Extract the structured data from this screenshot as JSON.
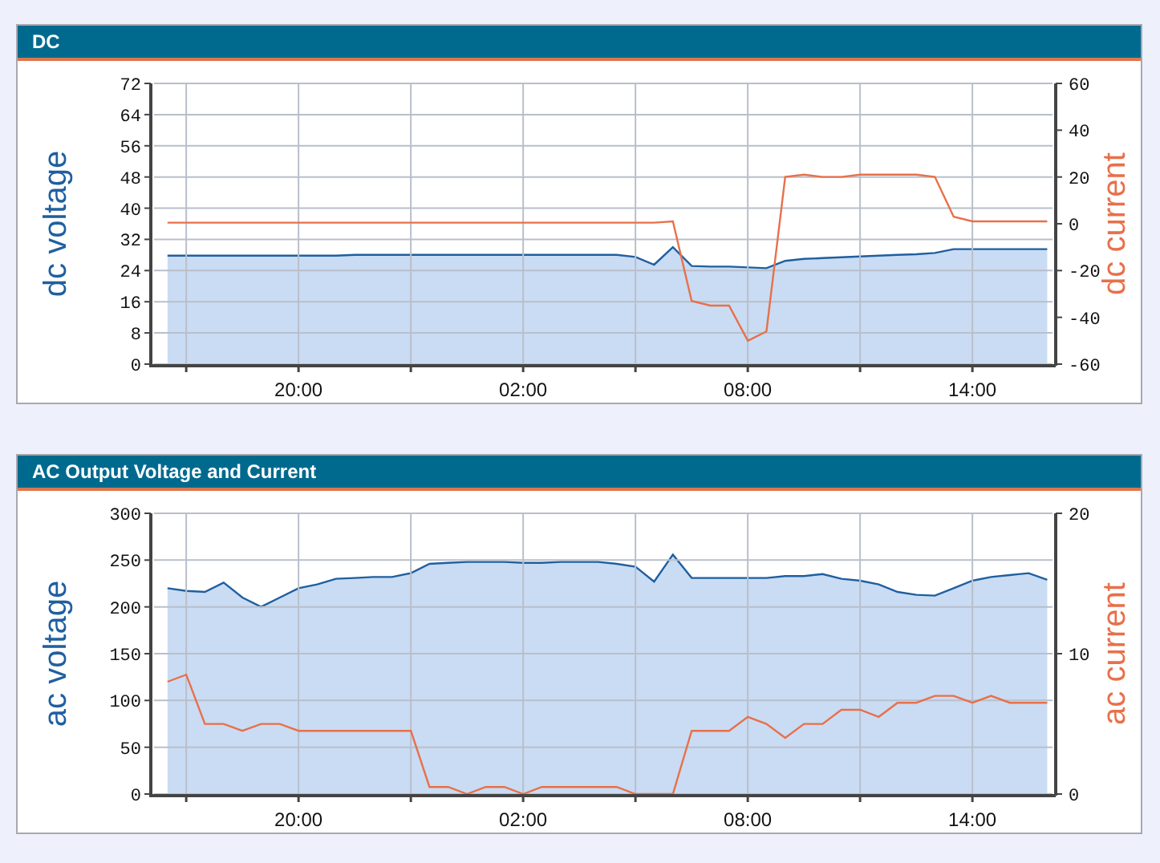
{
  "panels": [
    {
      "title": "DC",
      "chart_data": {
        "type": "area",
        "grid": true,
        "ylabel": "dc voltage",
        "y2label": "dc current",
        "categories": [
          null,
          null,
          null,
          null,
          null,
          null,
          null,
          "20:00",
          null,
          null,
          null,
          null,
          null,
          null,
          null,
          null,
          null,
          null,
          null,
          "02:00",
          null,
          null,
          null,
          null,
          null,
          null,
          null,
          null,
          null,
          null,
          null,
          "08:00",
          null,
          null,
          null,
          null,
          null,
          null,
          null,
          null,
          null,
          null,
          null,
          "14:00",
          null,
          null,
          null,
          null
        ],
        "ylim": [
          0,
          72
        ],
        "yticks": [
          0,
          8,
          16,
          24,
          32,
          40,
          48,
          56,
          64,
          72
        ],
        "y2lim": [
          -60,
          60
        ],
        "y2ticks": [
          -60,
          -40,
          -20,
          0,
          20,
          40,
          60
        ],
        "series": [
          {
            "color": "#1f5fa0",
            "values": [
              27.8,
              27.8,
              27.8,
              27.8,
              27.8,
              27.8,
              27.8,
              27.8,
              27.8,
              27.8,
              28,
              28,
              28,
              28,
              28,
              28,
              28,
              28,
              28,
              28,
              28,
              28,
              28,
              28,
              28,
              27.5,
              25.5,
              30,
              25.2,
              25,
              25,
              24.8,
              24.6,
              26.5,
              27,
              27.2,
              27.4,
              27.6,
              27.8,
              28,
              28.2,
              28.5,
              29.5,
              29.5,
              29.5,
              29.5,
              29.5,
              29.5
            ]
          },
          {
            "type": "line",
            "axis": "y2",
            "color": "#e8704a",
            "values": [
              0.5,
              0.5,
              0.5,
              0.5,
              0.5,
              0.5,
              0.5,
              0.5,
              0.5,
              0.5,
              0.5,
              0.5,
              0.5,
              0.5,
              0.5,
              0.5,
              0.5,
              0.5,
              0.5,
              0.5,
              0.5,
              0.5,
              0.5,
              0.5,
              0.5,
              0.5,
              0.5,
              1,
              -33,
              -35,
              -35,
              -50,
              -46,
              20,
              21,
              20,
              20,
              21,
              21,
              21,
              21,
              20,
              3,
              1,
              1,
              1,
              1,
              1
            ]
          }
        ]
      }
    },
    {
      "title": "AC Output Voltage and Current",
      "chart_data": {
        "type": "area",
        "grid": true,
        "ylabel": "ac voltage",
        "y2label": "ac current",
        "categories": [
          null,
          null,
          null,
          null,
          null,
          null,
          null,
          "20:00",
          null,
          null,
          null,
          null,
          null,
          null,
          null,
          null,
          null,
          null,
          null,
          "02:00",
          null,
          null,
          null,
          null,
          null,
          null,
          null,
          null,
          null,
          null,
          null,
          "08:00",
          null,
          null,
          null,
          null,
          null,
          null,
          null,
          null,
          null,
          null,
          null,
          "14:00",
          null,
          null,
          null,
          null
        ],
        "ylim": [
          0,
          300
        ],
        "yticks": [
          0,
          50,
          100,
          150,
          200,
          250,
          300
        ],
        "y2lim": [
          0,
          20
        ],
        "y2ticks": [
          0,
          10,
          20
        ],
        "series": [
          {
            "color": "#1f5fa0",
            "values": [
              220,
              217,
              216,
              226,
              210,
              200,
              210,
              220,
              224,
              230,
              231,
              232,
              232,
              236,
              246,
              247,
              248,
              248,
              248,
              247,
              247,
              248,
              248,
              248,
              246,
              243,
              227,
              256,
              231,
              231,
              231,
              231,
              231,
              233,
              233,
              235,
              230,
              228,
              224,
              216,
              213,
              212,
              220,
              228,
              232,
              234,
              236,
              229
            ]
          },
          {
            "type": "line",
            "axis": "y2",
            "color": "#e8704a",
            "values": [
              8,
              8.5,
              5,
              5,
              4.5,
              5,
              5,
              4.5,
              4.5,
              4.5,
              4.5,
              4.5,
              4.5,
              4.5,
              0.5,
              0.5,
              0,
              0.5,
              0.5,
              0,
              0.5,
              0.5,
              0.5,
              0.5,
              0.5,
              0,
              0,
              0,
              4.5,
              4.5,
              4.5,
              5.5,
              5,
              4,
              5,
              5,
              6,
              6,
              5.5,
              6.5,
              6.5,
              7,
              7,
              6.5,
              7,
              6.5,
              6.5,
              6.5
            ]
          }
        ]
      }
    }
  ]
}
